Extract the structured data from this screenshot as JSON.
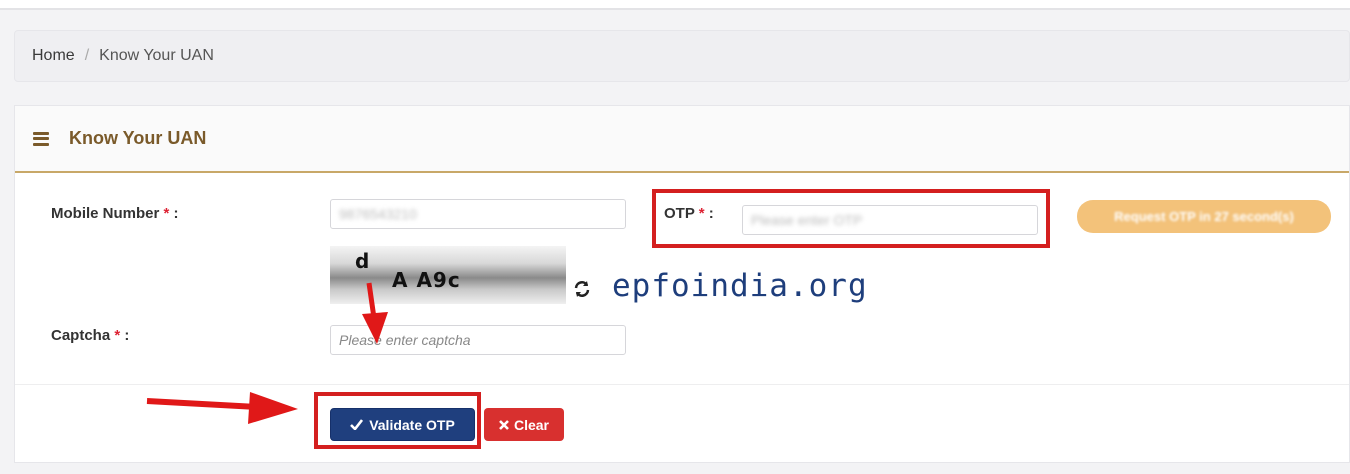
{
  "breadcrumb": {
    "home": "Home",
    "separator": "/",
    "current": "Know Your UAN"
  },
  "card": {
    "title": "Know Your UAN"
  },
  "form": {
    "mobile_label": "Mobile Number",
    "mobile_value": "9876543210",
    "otp_label": "OTP",
    "otp_placeholder": "Please enter OTP",
    "request_otp_label": "Request OTP in 27 second(s)",
    "captcha_label": "Captcha",
    "captcha_placeholder": "Please enter captcha",
    "captcha_line1": "d",
    "captcha_line2": "A A9c",
    "required_mark": "*",
    "label_suffix": ":"
  },
  "buttons": {
    "validate": "Validate OTP",
    "clear": "Clear"
  },
  "watermark": "epfoindia.org",
  "colors": {
    "accent_brown": "#7a5a2a",
    "primary": "#1f3f7e",
    "danger": "#d8302f",
    "otp_button": "#f3c27a",
    "highlight": "#d41f1f"
  }
}
